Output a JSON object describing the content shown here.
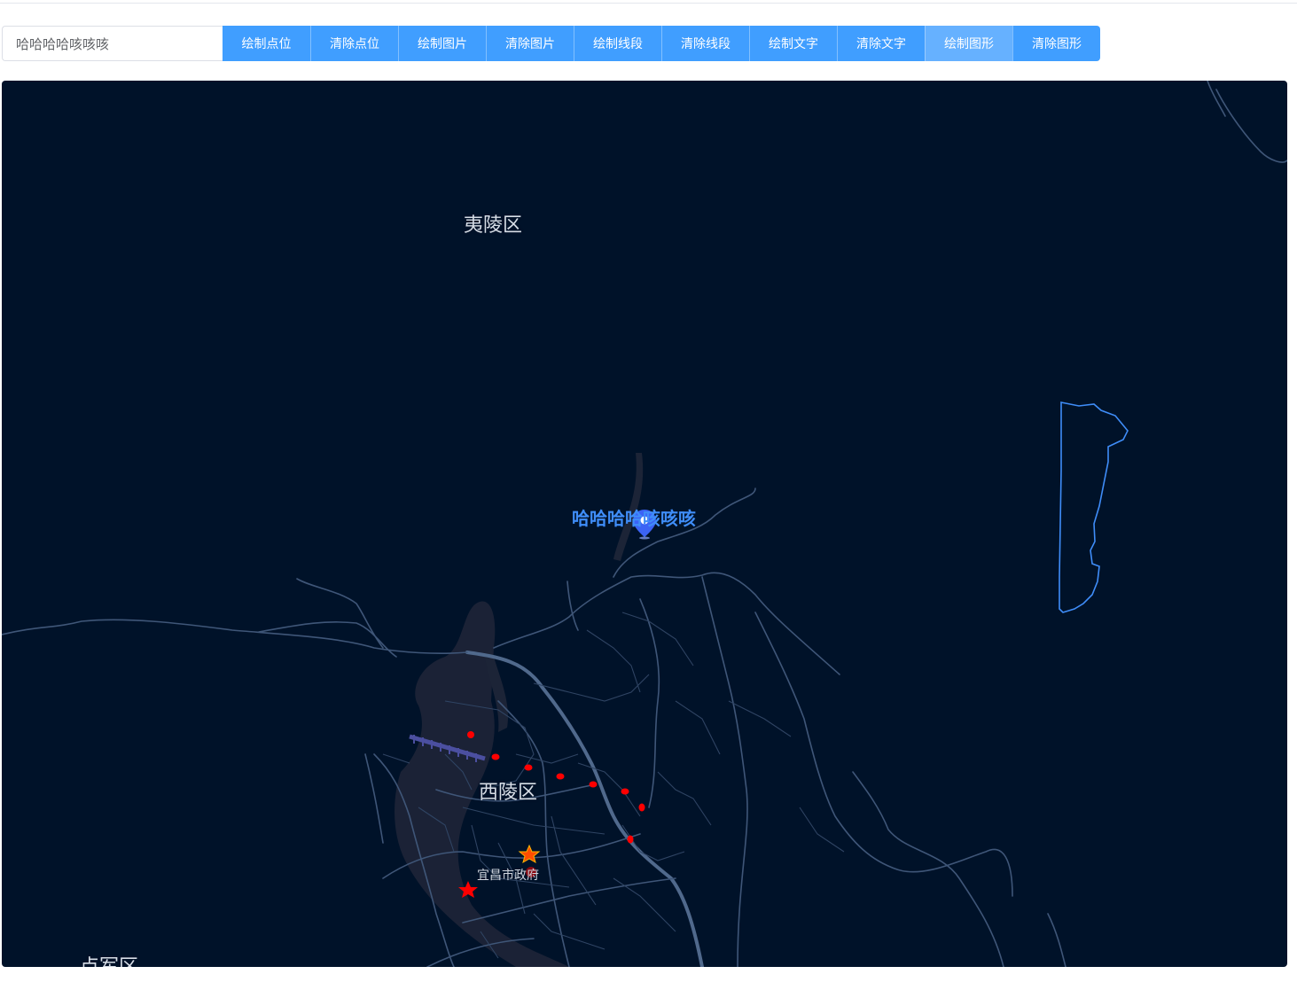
{
  "toolbar": {
    "input_value": "哈哈哈哈咳咳咳",
    "buttons": [
      {
        "label": "绘制点位"
      },
      {
        "label": "清除点位"
      },
      {
        "label": "绘制图片"
      },
      {
        "label": "清除图片"
      },
      {
        "label": "绘制线段"
      },
      {
        "label": "清除线段"
      },
      {
        "label": "绘制文字"
      },
      {
        "label": "清除文字"
      },
      {
        "label": "绘制图形"
      },
      {
        "label": "清除图形"
      }
    ]
  },
  "map": {
    "background_color": "#001229",
    "road_color": "#4e6a8e",
    "accent_color": "#3f8df8",
    "marker_dot_color": "#ff0000",
    "districts": {
      "yiling": "夷陵区",
      "xiling": "西陵区",
      "dianjun": "点军区"
    },
    "poi": {
      "gov": "宜昌市政府"
    },
    "marker": {
      "label": "哈哈哈哈咳咳咳",
      "icon": "map-pin-icon"
    }
  }
}
